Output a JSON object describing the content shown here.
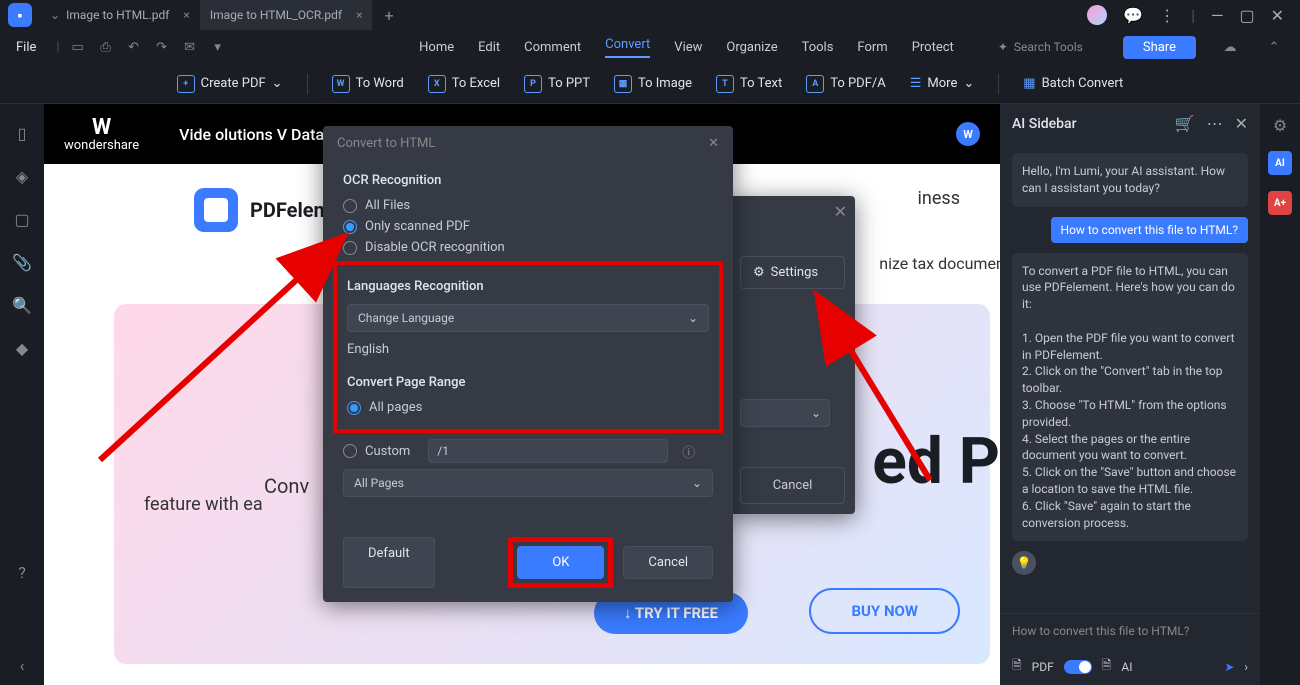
{
  "tabs": {
    "tab1": "Image to HTML.pdf",
    "tab2": "Image to HTML_OCR.pdf"
  },
  "menubar": {
    "file": "File"
  },
  "topnav": {
    "home": "Home",
    "edit": "Edit",
    "comment": "Comment",
    "convert": "Convert",
    "view": "View",
    "organize": "Organize",
    "tools": "Tools",
    "form": "Form",
    "protect": "Protect",
    "search": "Search Tools",
    "share": "Share"
  },
  "toolbar": {
    "create": "Create PDF",
    "word": "To Word",
    "excel": "To Excel",
    "ppt": "To PPT",
    "image": "To Image",
    "text": "To Text",
    "pdfa": "To PDF/A",
    "more": "More",
    "batch": "Batch Convert"
  },
  "doc": {
    "logo_top": "W",
    "logo_sub": "wondershare",
    "title": "Vide                                                                                     olutions V Data Management",
    "pdfel": "PDFelem",
    "business": "iness",
    "tax": "nize tax document",
    "big": "ed P",
    "hero": "feature with ea",
    "conv": "Conv",
    "buy": "BUY NOW",
    "try": "TRY IT FREE"
  },
  "dialog": {
    "title": "Convert to HTML",
    "ocr_heading": "OCR Recognition",
    "r_all": "All Files",
    "r_scanned": "Only scanned PDF",
    "r_disable": "Disable OCR recognition",
    "lang_heading": "Languages Recognition",
    "change_lang": "Change Language",
    "english": "English",
    "range_heading": "Convert Page Range",
    "r_allpages": "All pages",
    "r_custom": "Custom",
    "custom_val": "/1",
    "allpages_sel": "All Pages",
    "default": "Default",
    "ok": "OK",
    "cancel": "Cancel"
  },
  "under": {
    "settings": "Settings",
    "cancel": "Cancel"
  },
  "sidebar": {
    "title": "AI Sidebar",
    "greeting": "Hello, I'm Lumi, your AI assistant. How can I assistant you today?",
    "user_msg": "How to convert this file to HTML?",
    "reply": "To convert a PDF file to HTML, you can use PDFelement. Here's how you can do it:\n\n1. Open the PDF file you want to convert in PDFelement.\n2. Click on the \"Convert\" tab in the top toolbar.\n3. Choose \"To HTML\" from the options provided.\n4. Select the pages or the entire document you want to convert.\n5. Click on the \"Save\" button and choose a location to save the HTML file.\n6. Click \"Save\" again to start the conversion process.",
    "input_ph": "How to convert this file to HTML?",
    "pdf": "PDF",
    "ai": "AI"
  }
}
